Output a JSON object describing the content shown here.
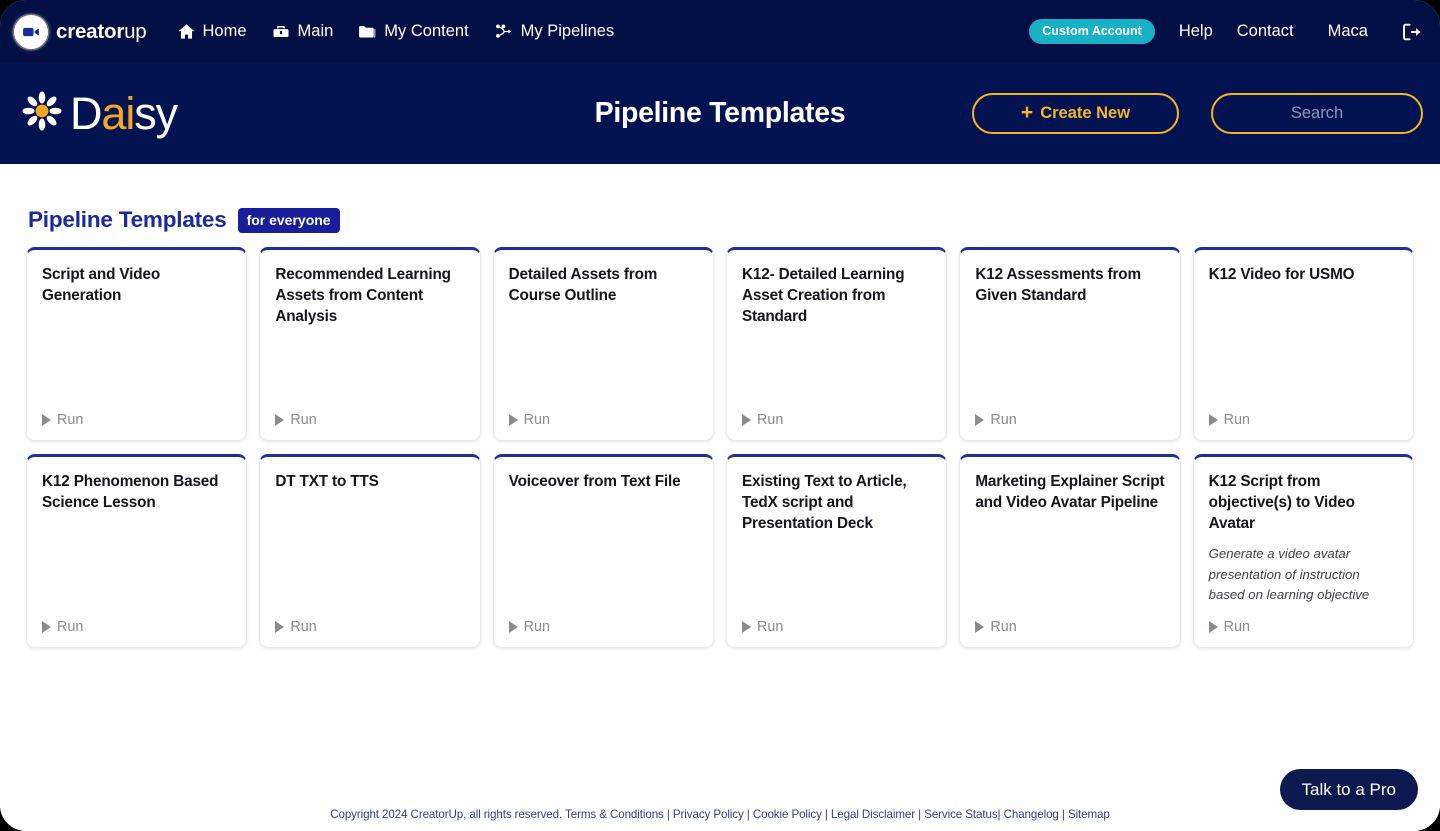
{
  "topnav": {
    "brand": {
      "name_bold": "creator",
      "name_light": "up",
      "logo_icon": "video-camera-icon"
    },
    "links": [
      {
        "label": "Home",
        "icon": "home-icon"
      },
      {
        "label": "Main",
        "icon": "toolbox-icon"
      },
      {
        "label": "My Content",
        "icon": "folder-icon"
      },
      {
        "label": "My Pipelines",
        "icon": "pipeline-nodes-icon"
      }
    ],
    "account_badge": "Custom Account",
    "help": "Help",
    "contact": "Contact",
    "user": "Maca",
    "logout_icon": "logout-icon"
  },
  "header": {
    "logo_text_1": "D",
    "logo_text_2": "ai",
    "logo_text_3": "sy",
    "logo_icon": "daisy-flower-icon",
    "title": "Pipeline Templates",
    "create_new": "Create New",
    "create_new_plus": "+",
    "search_placeholder": "Search",
    "search_value": ""
  },
  "section": {
    "title": "Pipeline Templates",
    "badge": "for everyone"
  },
  "cards": [
    {
      "title": "Script and Video Generation",
      "desc": "",
      "run": "Run"
    },
    {
      "title": "Recommended Learning Assets from Content Analysis",
      "desc": "",
      "run": "Run"
    },
    {
      "title": "Detailed Assets from Course Outline",
      "desc": "",
      "run": "Run"
    },
    {
      "title": "K12- Detailed Learning Asset Creation from Standard",
      "desc": "",
      "run": "Run"
    },
    {
      "title": "K12 Assessments from Given Standard",
      "desc": "",
      "run": "Run"
    },
    {
      "title": "K12 Video for USMO",
      "desc": "",
      "run": "Run"
    },
    {
      "title": "K12 Phenomenon Based Science Lesson",
      "desc": "",
      "run": "Run"
    },
    {
      "title": "DT TXT to TTS",
      "desc": "",
      "run": "Run"
    },
    {
      "title": "Voiceover from Text File",
      "desc": "",
      "run": "Run"
    },
    {
      "title": "Existing Text to Article, TedX script and Presentation Deck",
      "desc": "",
      "run": "Run"
    },
    {
      "title": "Marketing Explainer Script and Video Avatar Pipeline",
      "desc": "",
      "run": "Run"
    },
    {
      "title": "K12 Script from objective(s) to Video Avatar",
      "desc": "Generate a video avatar presentation of instruction based on learning objective",
      "run": "Run"
    }
  ],
  "footer": {
    "copyright": "Copyright 2024 CreatorUp, all rights reserved.",
    "links": [
      "Terms & Conditions",
      "Privacy Policy",
      "Cookie Policy",
      "Legal Disclaimer",
      "Service Status",
      "Changelog",
      "Sitemap"
    ]
  },
  "talk_to_pro": "Talk to a Pro",
  "colors": {
    "topnav_bg": "#030f45",
    "header_bg": "#031351",
    "accent_gold": "#f5b425",
    "accent_teal": "#17b0c4",
    "card_top_border": "#1f2f9c",
    "section_title": "#1b2a9b"
  }
}
